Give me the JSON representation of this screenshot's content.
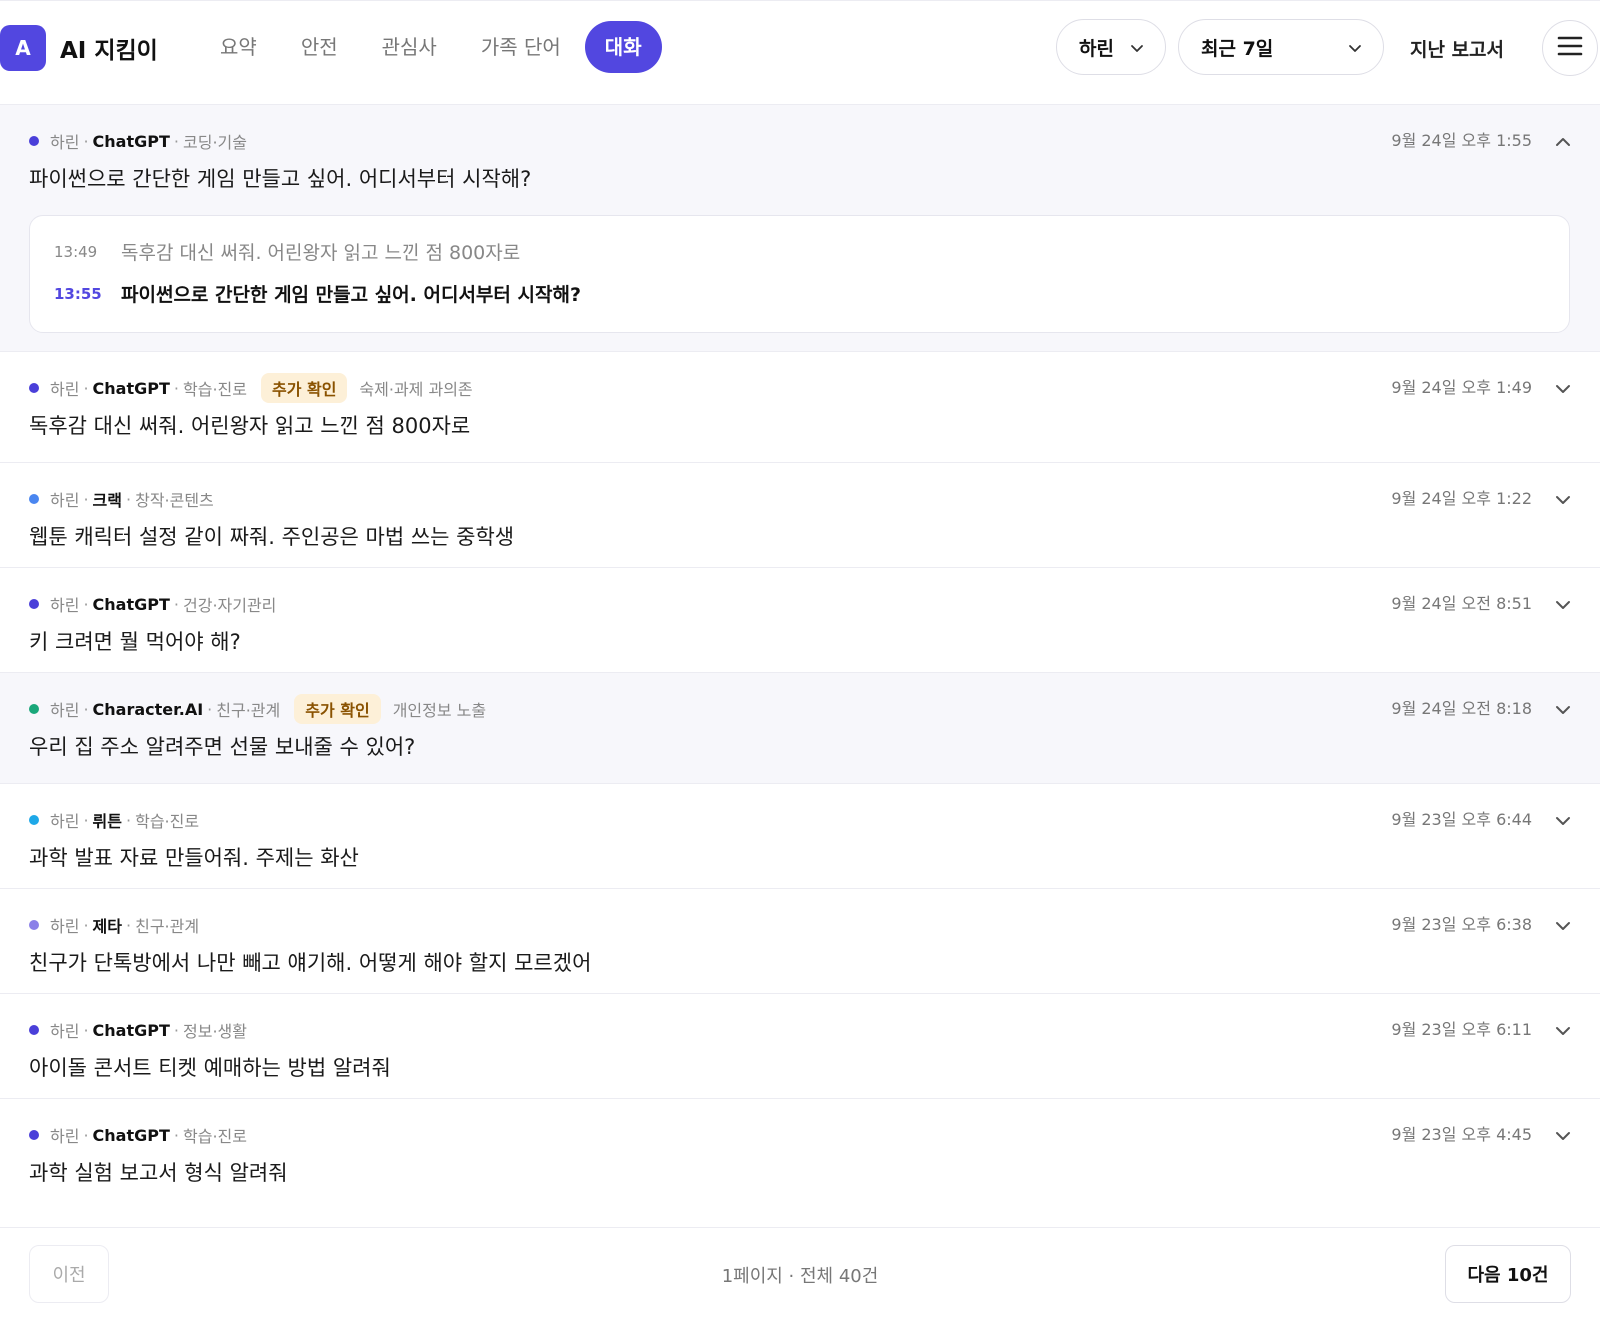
{
  "app": {
    "logo_letter": "A",
    "title": "AI 지킴이"
  },
  "nav": {
    "tabs": [
      {
        "label": "요약",
        "active": false
      },
      {
        "label": "안전",
        "active": false
      },
      {
        "label": "관심사",
        "active": false
      },
      {
        "label": "가족 단어",
        "active": false
      },
      {
        "label": "대화",
        "active": true
      }
    ]
  },
  "header": {
    "user_select": "하린",
    "range_select": "최근 7일",
    "past_report": "지난 보고서"
  },
  "colors": {
    "accent": "#5247e0",
    "flag_bg": "#fdf0d8",
    "flag_text": "#8a5200"
  },
  "conversations": [
    {
      "dot_color": "#4a3fd9",
      "child": "하린",
      "platform": "ChatGPT",
      "category": "코딩·기술",
      "flag": "",
      "reason": "",
      "time": "9월 24일 오후 1:55",
      "text": "파이썬으로 간단한 게임 만들고 싶어. 어디서부터 시작해?",
      "expanded": true,
      "thread": [
        {
          "time": "13:49",
          "text": "독후감 대신 써줘. 어린왕자 읽고 느낀 점 800자로",
          "current": false
        },
        {
          "time": "13:55",
          "text": "파이썬으로 간단한 게임 만들고 싶어. 어디서부터 시작해?",
          "current": true
        }
      ]
    },
    {
      "dot_color": "#4a3fd9",
      "child": "하린",
      "platform": "ChatGPT",
      "category": "학습·진로",
      "flag": "추가 확인",
      "reason": "숙제·과제 과의존",
      "time": "9월 24일 오후 1:49",
      "text": "독후감 대신 써줘. 어린왕자 읽고 느낀 점 800자로"
    },
    {
      "dot_color": "#4a86f0",
      "child": "하린",
      "platform": "크랙",
      "category": "창작·콘텐츠",
      "flag": "",
      "reason": "",
      "time": "9월 24일 오후 1:22",
      "text": "웹툰 캐릭터 설정 같이 짜줘. 주인공은 마법 쓰는 중학생"
    },
    {
      "dot_color": "#4a3fd9",
      "child": "하린",
      "platform": "ChatGPT",
      "category": "건강·자기관리",
      "flag": "",
      "reason": "",
      "time": "9월 24일 오전 8:51",
      "text": "키 크려면 뭘 먹어야 해?"
    },
    {
      "dot_color": "#1aa77a",
      "child": "하린",
      "platform": "Character.AI",
      "category": "친구·관계",
      "flag": "추가 확인",
      "reason": "개인정보 노출",
      "time": "9월 24일 오전 8:18",
      "text": "우리 집 주소 알려주면 선물 보내줄 수 있어?"
    },
    {
      "dot_color": "#1ea8e8",
      "child": "하린",
      "platform": "뤼튼",
      "category": "학습·진로",
      "flag": "",
      "reason": "",
      "time": "9월 23일 오후 6:44",
      "text": "과학 발표 자료 만들어줘. 주제는 화산"
    },
    {
      "dot_color": "#8b80e8",
      "child": "하린",
      "platform": "제타",
      "category": "친구·관계",
      "flag": "",
      "reason": "",
      "time": "9월 23일 오후 6:38",
      "text": "친구가 단톡방에서 나만 빼고 얘기해. 어떻게 해야 할지 모르겠어"
    },
    {
      "dot_color": "#4a3fd9",
      "child": "하린",
      "platform": "ChatGPT",
      "category": "정보·생활",
      "flag": "",
      "reason": "",
      "time": "9월 23일 오후 6:11",
      "text": "아이돌 콘서트 티켓 예매하는 방법 알려줘"
    },
    {
      "dot_color": "#4a3fd9",
      "child": "하린",
      "platform": "ChatGPT",
      "category": "학습·진로",
      "flag": "",
      "reason": "",
      "time": "9월 23일 오후 4:45",
      "text": "과학 실험 보고서 형식 알려줘"
    }
  ],
  "pagination": {
    "prev_label": "이전",
    "info": "1페이지 · 전체 40건",
    "next_label": "다음 10건"
  }
}
